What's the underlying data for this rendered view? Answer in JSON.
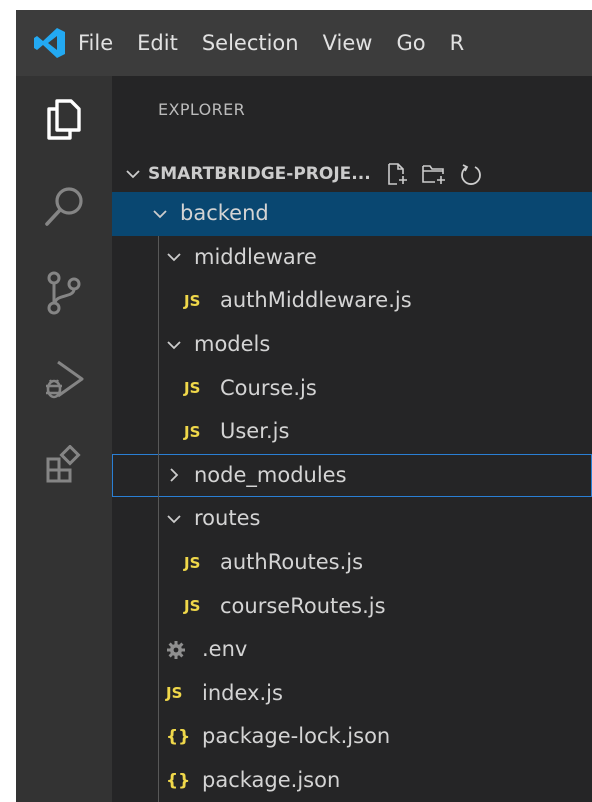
{
  "menu": [
    "File",
    "Edit",
    "Selection",
    "View",
    "Go",
    "R"
  ],
  "explorer": {
    "title": "EXPLORER",
    "project": "SMARTBRIDGE-PROJE..."
  },
  "tree": [
    {
      "label": "backend",
      "type": "folder",
      "expanded": true,
      "depth": 0,
      "selected": true
    },
    {
      "label": "middleware",
      "type": "folder",
      "expanded": true,
      "depth": 1
    },
    {
      "label": "authMiddleware.js",
      "type": "js",
      "depth": 2,
      "badge": "JS"
    },
    {
      "label": "models",
      "type": "folder",
      "expanded": true,
      "depth": 1
    },
    {
      "label": "Course.js",
      "type": "js",
      "depth": 2,
      "badge": "JS"
    },
    {
      "label": "User.js",
      "type": "js",
      "depth": 2,
      "badge": "JS"
    },
    {
      "label": "node_modules",
      "type": "folder",
      "expanded": false,
      "depth": 1,
      "focused": true
    },
    {
      "label": "routes",
      "type": "folder",
      "expanded": true,
      "depth": 1
    },
    {
      "label": "authRoutes.js",
      "type": "js",
      "depth": 2,
      "badge": "JS"
    },
    {
      "label": "courseRoutes.js",
      "type": "js",
      "depth": 2,
      "badge": "JS"
    },
    {
      "label": ".env",
      "type": "env",
      "depth": 1
    },
    {
      "label": "index.js",
      "type": "js",
      "depth": 1,
      "badge": "JS"
    },
    {
      "label": "package-lock.json",
      "type": "json",
      "depth": 1,
      "badge": "{}"
    },
    {
      "label": "package.json",
      "type": "json",
      "depth": 1,
      "badge": "{}"
    }
  ],
  "colors": {
    "titlebar": "#3c3c3c",
    "activitybar": "#333333",
    "sidebar": "#252526",
    "selection": "#094771",
    "focus_border": "#2a7fd4",
    "js_badge": "#f0d84a",
    "vscode_blue": "#23a9f2"
  }
}
